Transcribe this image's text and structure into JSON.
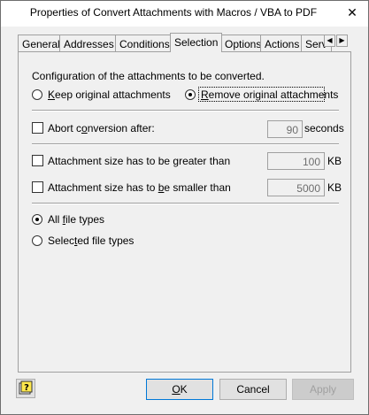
{
  "window": {
    "title": "Properties of Convert Attachments with Macros / VBA to PDF",
    "close_glyph": "✕"
  },
  "tabs": [
    {
      "label": "General",
      "active": false
    },
    {
      "label": "Addresses",
      "active": false
    },
    {
      "label": "Conditions",
      "active": false
    },
    {
      "label": "Selection",
      "active": true
    },
    {
      "label": "Options",
      "active": false
    },
    {
      "label": "Actions",
      "active": false
    },
    {
      "label": "Serv",
      "active": false
    }
  ],
  "tab_scroll": {
    "left_glyph": "◀",
    "right_glyph": "▶"
  },
  "selection": {
    "config_label": "Configuration of the attachments to be converted.",
    "keep": {
      "before": "",
      "accel": "K",
      "after": "eep original attachments",
      "checked": false
    },
    "remove": {
      "before": "",
      "accel": "R",
      "after": "emove original attachments",
      "checked": true
    },
    "abort": {
      "before": "Abort c",
      "accel": "o",
      "after": "nversion after:",
      "checked": false,
      "value": "90",
      "unit": "seconds"
    },
    "greater": {
      "before": "Attachment size has to be greater than",
      "accel": "",
      "after": "",
      "checked": false,
      "value": "100",
      "unit": "KB"
    },
    "smaller": {
      "before": "Attachment size has to ",
      "accel": "b",
      "after": "e smaller than",
      "checked": false,
      "value": "5000",
      "unit": "KB"
    },
    "all_types": {
      "before": "All ",
      "accel": "f",
      "after": "ile types",
      "checked": true
    },
    "selected_types": {
      "before": "Selec",
      "accel": "t",
      "after": "ed file types",
      "checked": false
    }
  },
  "buttons": {
    "ok": {
      "before": "",
      "accel": "O",
      "after": "K"
    },
    "cancel": {
      "before": "Cancel",
      "accel": "",
      "after": ""
    },
    "apply": {
      "before": "Apply",
      "accel": "",
      "after": ""
    },
    "help_icon": "help-icon"
  }
}
